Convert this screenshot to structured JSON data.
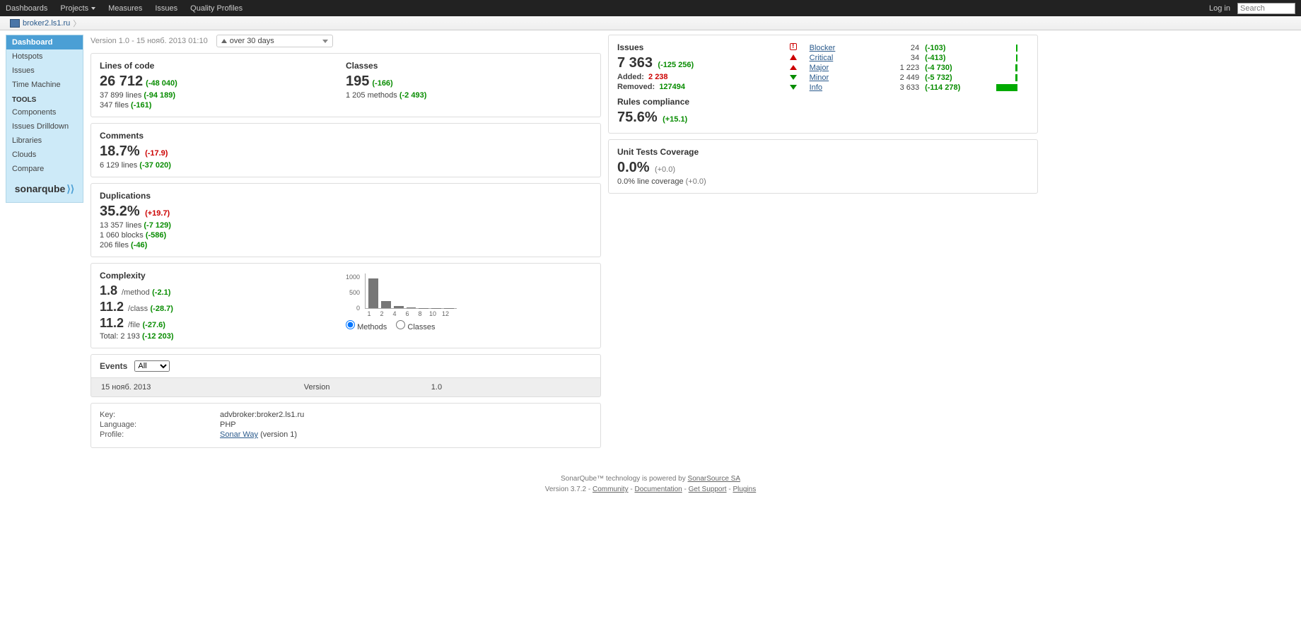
{
  "topnav": {
    "dashboards": "Dashboards",
    "projects": "Projects",
    "measures": "Measures",
    "issues": "Issues",
    "quality_profiles": "Quality Profiles",
    "login": "Log in",
    "search_placeholder": "Search"
  },
  "breadcrumb": {
    "project": "broker2.ls1.ru"
  },
  "sidebar": {
    "dashboard": "Dashboard",
    "hotspots": "Hotspots",
    "issues": "Issues",
    "time_machine": "Time Machine",
    "tools_header": "TOOLS",
    "components": "Components",
    "issues_drilldown": "Issues Drilldown",
    "libraries": "Libraries",
    "clouds": "Clouds",
    "compare": "Compare",
    "logo": "sonarqube"
  },
  "version_bar": {
    "text": "Version 1.0 - 15 нояб. 2013 01:10",
    "delta_option": "over 30 days"
  },
  "loc": {
    "title": "Lines of code",
    "value": "26 712",
    "delta": "(-48 040)",
    "lines": "37 899 lines",
    "lines_delta": "(-94 189)",
    "files": "347 files",
    "files_delta": "(-161)"
  },
  "classes": {
    "title": "Classes",
    "value": "195",
    "delta": "(-166)",
    "methods": "1 205 methods",
    "methods_delta": "(-2 493)"
  },
  "comments": {
    "title": "Comments",
    "value": "18.7%",
    "delta": "(-17.9)",
    "lines": "6 129 lines",
    "lines_delta": "(-37 020)"
  },
  "duplications": {
    "title": "Duplications",
    "value": "35.2%",
    "delta": "(+19.7)",
    "lines": "13 357 lines",
    "lines_delta": "(-7 129)",
    "blocks": "1 060 blocks",
    "blocks_delta": "(-586)",
    "files": "206 files",
    "files_delta": "(-46)"
  },
  "complexity_panel": {
    "title": "Complexity",
    "method_val": "1.8",
    "method_unit": "/method",
    "method_delta": "(-2.1)",
    "class_val": "11.2",
    "class_unit": "/class",
    "class_delta": "(-28.7)",
    "file_val": "11.2",
    "file_unit": "/file",
    "file_delta": "(-27.6)",
    "total": "Total: 2 193",
    "total_delta": "(-12 203)",
    "radio_methods": "Methods",
    "radio_classes": "Classes"
  },
  "chart_data": {
    "type": "bar",
    "categories": [
      "1",
      "2",
      "4",
      "6",
      "8",
      "10",
      "12"
    ],
    "values": [
      850,
      200,
      60,
      30,
      10,
      10,
      5
    ],
    "y_ticks": [
      "0",
      "500",
      "1000"
    ],
    "ylim": [
      0,
      1000
    ]
  },
  "events": {
    "title": "Events",
    "filter": "All",
    "row": {
      "date": "15 нояб. 2013",
      "col2": "Version",
      "col3": "1.0"
    }
  },
  "info": {
    "key_label": "Key:",
    "key_value": "advbroker:broker2.ls1.ru",
    "lang_label": "Language:",
    "lang_value": "PHP",
    "profile_label": "Profile:",
    "profile_link": "Sonar Way",
    "profile_suffix": " (version 1)"
  },
  "issues": {
    "title": "Issues",
    "value": "7 363",
    "delta": "(-125 256)",
    "added_label": "Added:",
    "added_value": "2 238",
    "removed_label": "Removed:",
    "removed_value": "127494",
    "rules_label": "Rules compliance",
    "rules_value": "75.6%",
    "rules_delta": "(+15.1)",
    "severities": [
      {
        "name": "Blocker",
        "count": "24",
        "delta": "(-103)",
        "bar": 2
      },
      {
        "name": "Critical",
        "count": "34",
        "delta": "(-413)",
        "bar": 2
      },
      {
        "name": "Major",
        "count": "1 223",
        "delta": "(-4 730)",
        "bar": 3
      },
      {
        "name": "Minor",
        "count": "2 449",
        "delta": "(-5 732)",
        "bar": 3
      },
      {
        "name": "Info",
        "count": "3 633",
        "delta": "(-114 278)",
        "bar": 30
      }
    ]
  },
  "coverage": {
    "title": "Unit Tests Coverage",
    "value": "0.0%",
    "delta": "(+0.0)",
    "line": "0.0% line coverage",
    "line_delta": "(+0.0)"
  },
  "footer": {
    "line1a": "SonarQube™ technology is powered by ",
    "line1b": "SonarSource SA",
    "version": "Version 3.7.2 - ",
    "community": "Community",
    "documentation": "Documentation",
    "support": "Get Support",
    "plugins": "Plugins"
  }
}
